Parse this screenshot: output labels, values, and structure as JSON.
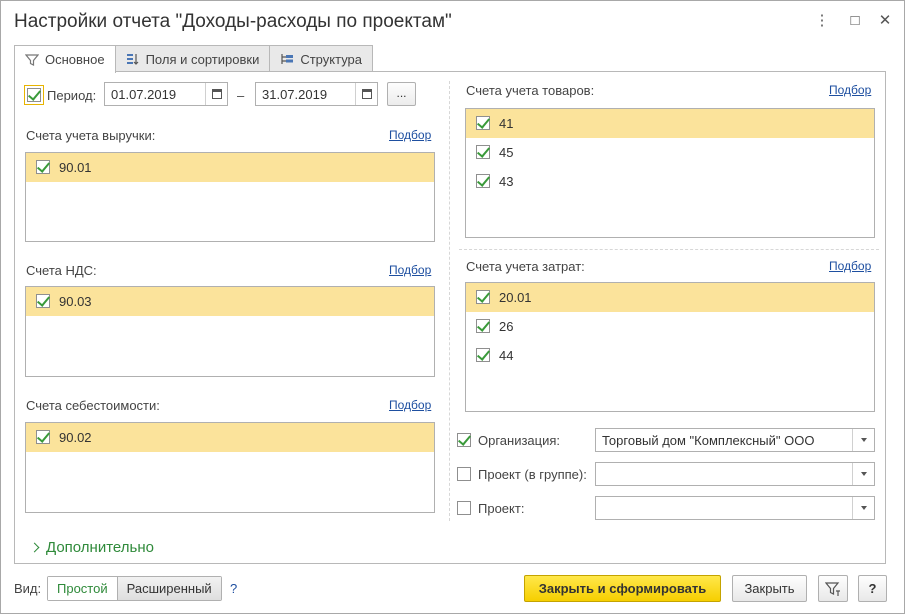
{
  "window": {
    "title": "Настройки отчета \"Доходы-расходы по проектам\"",
    "more_icon": "⋮",
    "maximize_icon": "□",
    "close_icon": "✕"
  },
  "tabs": [
    {
      "label": "Основное",
      "icon": "filter-icon",
      "active": true
    },
    {
      "label": "Поля и сортировки",
      "icon": "fields-icon",
      "active": false
    },
    {
      "label": "Структура",
      "icon": "structure-icon",
      "active": false
    }
  ],
  "period": {
    "label": "Период:",
    "checked": true,
    "from": "01.07.2019",
    "dash": "–",
    "to": "31.07.2019",
    "more_button": "..."
  },
  "pick_label": "Подбор",
  "revenue_accounts": {
    "label": "Счета учета выручки:",
    "items": [
      {
        "value": "90.01",
        "checked": true
      }
    ]
  },
  "vat_accounts": {
    "label": "Счета НДС:",
    "items": [
      {
        "value": "90.03",
        "checked": true
      }
    ]
  },
  "cost_accounts": {
    "label": "Счета себестоимости:",
    "items": [
      {
        "value": "90.02",
        "checked": true
      }
    ]
  },
  "goods_accounts": {
    "label": "Счета учета товаров:",
    "items": [
      {
        "value": "41",
        "checked": true
      },
      {
        "value": "45",
        "checked": true
      },
      {
        "value": "43",
        "checked": true
      }
    ]
  },
  "expense_accounts": {
    "label": "Счета учета затрат:",
    "items": [
      {
        "value": "20.01",
        "checked": true
      },
      {
        "value": "26",
        "checked": true
      },
      {
        "value": "44",
        "checked": true
      }
    ]
  },
  "filters": {
    "organization": {
      "label": "Организация:",
      "checked": true,
      "value": "Торговый дом \"Комплексный\" ООО"
    },
    "project_group": {
      "label": "Проект (в группе):",
      "checked": false,
      "value": ""
    },
    "project": {
      "label": "Проект:",
      "checked": false,
      "value": ""
    }
  },
  "advanced_label": "Дополнительно",
  "footer": {
    "view_label": "Вид:",
    "simple": "Простой",
    "extended": "Расширенный",
    "help": "?",
    "close_and_run": "Закрыть и сформировать",
    "close": "Закрыть",
    "question": "?"
  },
  "colors": {
    "selected_row": "#fbe39b",
    "accent_green": "#2f8a3a",
    "link_blue": "#1e4fa0",
    "primary_button": "#f6cf00"
  }
}
